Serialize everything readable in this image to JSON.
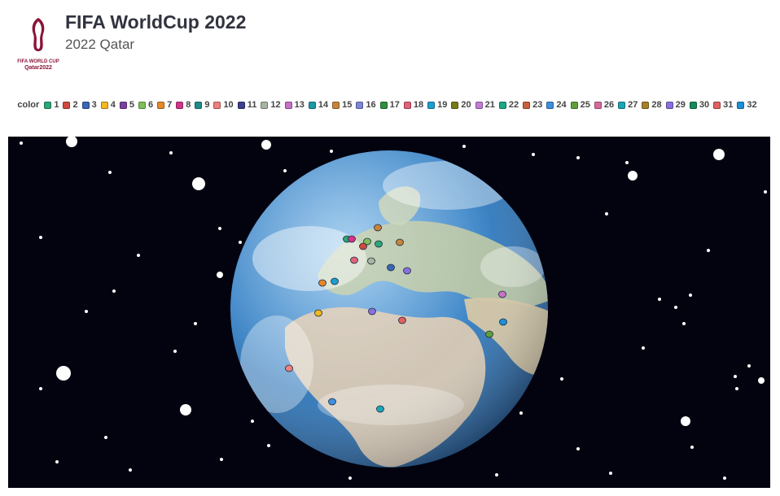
{
  "header": {
    "title": "FIFA WorldCup 2022",
    "subtitle": "2022 Qatar",
    "logo_text_line1": "FIFA WORLD CUP",
    "logo_text_line2": "Qatar2022"
  },
  "legend": {
    "title": "color",
    "items": [
      {
        "label": "1",
        "color": "#2aa876"
      },
      {
        "label": "2",
        "color": "#cf4a3d"
      },
      {
        "label": "3",
        "color": "#3a66b8"
      },
      {
        "label": "4",
        "color": "#f2b81d"
      },
      {
        "label": "5",
        "color": "#7b3fa0"
      },
      {
        "label": "6",
        "color": "#7fbf5a"
      },
      {
        "label": "7",
        "color": "#e8872a"
      },
      {
        "label": "8",
        "color": "#d6338a"
      },
      {
        "label": "9",
        "color": "#1f8a8c"
      },
      {
        "label": "10",
        "color": "#f07f7f"
      },
      {
        "label": "11",
        "color": "#3b3f8f"
      },
      {
        "label": "12",
        "color": "#a8b5a0"
      },
      {
        "label": "13",
        "color": "#c871c8"
      },
      {
        "label": "14",
        "color": "#1b9aa6"
      },
      {
        "label": "15",
        "color": "#c8843c"
      },
      {
        "label": "16",
        "color": "#7f86d6"
      },
      {
        "label": "17",
        "color": "#2f8f3e"
      },
      {
        "label": "18",
        "color": "#e0627c"
      },
      {
        "label": "19",
        "color": "#1c9fd0"
      },
      {
        "label": "20",
        "color": "#7a7a18"
      },
      {
        "label": "21",
        "color": "#c47cd6"
      },
      {
        "label": "22",
        "color": "#1aa886"
      },
      {
        "label": "23",
        "color": "#c8603c"
      },
      {
        "label": "24",
        "color": "#3f8fe0"
      },
      {
        "label": "25",
        "color": "#5f9f3a"
      },
      {
        "label": "26",
        "color": "#d66a9c"
      },
      {
        "label": "27",
        "color": "#1ca5b8"
      },
      {
        "label": "28",
        "color": "#a5822a"
      },
      {
        "label": "29",
        "color": "#8a6fe0"
      },
      {
        "label": "30",
        "color": "#158a58"
      },
      {
        "label": "31",
        "color": "#e06060"
      },
      {
        "label": "32",
        "color": "#1c8fd8"
      }
    ]
  },
  "globe": {
    "background": "#02030f",
    "ocean_color": "#3f87c8",
    "land_color": "#b9c7a8"
  },
  "markers": [
    {
      "color": "#2aa876"
    },
    {
      "color": "#d6338a"
    },
    {
      "color": "#7fbf5a"
    },
    {
      "color": "#c8843c"
    },
    {
      "color": "#cf4a3d"
    },
    {
      "color": "#2aa876"
    },
    {
      "color": "#c8843c"
    },
    {
      "color": "#e0627c"
    },
    {
      "color": "#a8b5a0"
    },
    {
      "color": "#3a66b8"
    },
    {
      "color": "#8a6fe0"
    },
    {
      "color": "#e8872a"
    },
    {
      "color": "#1c9fd0"
    },
    {
      "color": "#f2b81d"
    },
    {
      "color": "#8a6fe0"
    },
    {
      "color": "#e06060"
    },
    {
      "color": "#c871c8"
    },
    {
      "color": "#1c8fd8"
    },
    {
      "color": "#5f9f3a"
    },
    {
      "color": "#f07f7f"
    },
    {
      "color": "#3f8fe0"
    },
    {
      "color": "#1ca5b8"
    }
  ]
}
